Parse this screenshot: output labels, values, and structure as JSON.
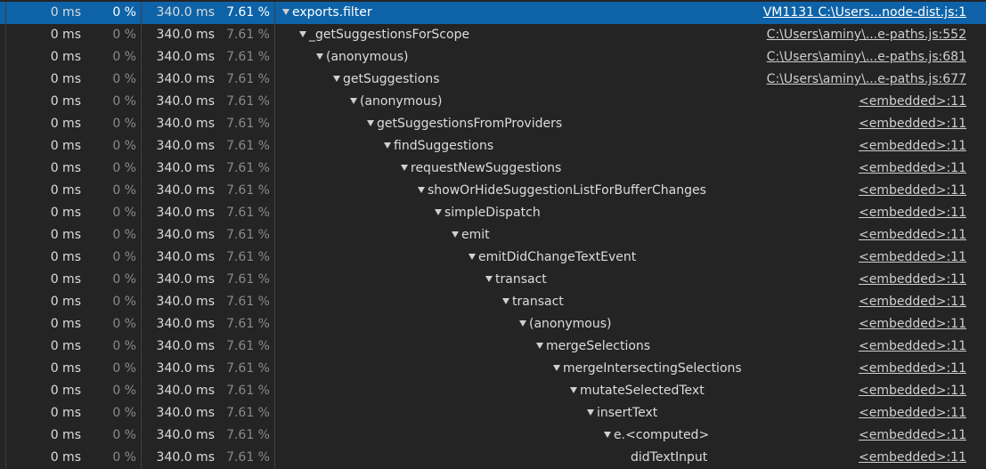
{
  "rows": [
    {
      "self": "0 ms",
      "self_pct": "0 %",
      "total": "340.0 ms",
      "total_pct": "7.61 %",
      "fn": "exports.filter",
      "src": "VM1131 C:\\Users...node-dist.js:1",
      "depth": 0,
      "expanded": true,
      "selected": true
    },
    {
      "self": "0 ms",
      "self_pct": "0 %",
      "total": "340.0 ms",
      "total_pct": "7.61 %",
      "fn": "_getSuggestionsForScope",
      "src": "C:\\Users\\aminy\\...e-paths.js:552",
      "depth": 1,
      "expanded": true
    },
    {
      "self": "0 ms",
      "self_pct": "0 %",
      "total": "340.0 ms",
      "total_pct": "7.61 %",
      "fn": "(anonymous)",
      "src": "C:\\Users\\aminy\\...e-paths.js:681",
      "depth": 2,
      "expanded": true
    },
    {
      "self": "0 ms",
      "self_pct": "0 %",
      "total": "340.0 ms",
      "total_pct": "7.61 %",
      "fn": "getSuggestions",
      "src": "C:\\Users\\aminy\\...e-paths.js:677",
      "depth": 3,
      "expanded": true
    },
    {
      "self": "0 ms",
      "self_pct": "0 %",
      "total": "340.0 ms",
      "total_pct": "7.61 %",
      "fn": "(anonymous)",
      "src": "<embedded>:11",
      "depth": 4,
      "expanded": true
    },
    {
      "self": "0 ms",
      "self_pct": "0 %",
      "total": "340.0 ms",
      "total_pct": "7.61 %",
      "fn": "getSuggestionsFromProviders",
      "src": "<embedded>:11",
      "depth": 5,
      "expanded": true
    },
    {
      "self": "0 ms",
      "self_pct": "0 %",
      "total": "340.0 ms",
      "total_pct": "7.61 %",
      "fn": "findSuggestions",
      "src": "<embedded>:11",
      "depth": 6,
      "expanded": true
    },
    {
      "self": "0 ms",
      "self_pct": "0 %",
      "total": "340.0 ms",
      "total_pct": "7.61 %",
      "fn": "requestNewSuggestions",
      "src": "<embedded>:11",
      "depth": 7,
      "expanded": true
    },
    {
      "self": "0 ms",
      "self_pct": "0 %",
      "total": "340.0 ms",
      "total_pct": "7.61 %",
      "fn": "showOrHideSuggestionListForBufferChanges",
      "src": "<embedded>:11",
      "depth": 8,
      "expanded": true
    },
    {
      "self": "0 ms",
      "self_pct": "0 %",
      "total": "340.0 ms",
      "total_pct": "7.61 %",
      "fn": "simpleDispatch",
      "src": "<embedded>:11",
      "depth": 9,
      "expanded": true
    },
    {
      "self": "0 ms",
      "self_pct": "0 %",
      "total": "340.0 ms",
      "total_pct": "7.61 %",
      "fn": "emit",
      "src": "<embedded>:11",
      "depth": 10,
      "expanded": true
    },
    {
      "self": "0 ms",
      "self_pct": "0 %",
      "total": "340.0 ms",
      "total_pct": "7.61 %",
      "fn": "emitDidChangeTextEvent",
      "src": "<embedded>:11",
      "depth": 11,
      "expanded": true
    },
    {
      "self": "0 ms",
      "self_pct": "0 %",
      "total": "340.0 ms",
      "total_pct": "7.61 %",
      "fn": "transact",
      "src": "<embedded>:11",
      "depth": 12,
      "expanded": true
    },
    {
      "self": "0 ms",
      "self_pct": "0 %",
      "total": "340.0 ms",
      "total_pct": "7.61 %",
      "fn": "transact",
      "src": "<embedded>:11",
      "depth": 13,
      "expanded": true
    },
    {
      "self": "0 ms",
      "self_pct": "0 %",
      "total": "340.0 ms",
      "total_pct": "7.61 %",
      "fn": "(anonymous)",
      "src": "<embedded>:11",
      "depth": 14,
      "expanded": true
    },
    {
      "self": "0 ms",
      "self_pct": "0 %",
      "total": "340.0 ms",
      "total_pct": "7.61 %",
      "fn": "mergeSelections",
      "src": "<embedded>:11",
      "depth": 15,
      "expanded": true
    },
    {
      "self": "0 ms",
      "self_pct": "0 %",
      "total": "340.0 ms",
      "total_pct": "7.61 %",
      "fn": "mergeIntersectingSelections",
      "src": "<embedded>:11",
      "depth": 16,
      "expanded": true
    },
    {
      "self": "0 ms",
      "self_pct": "0 %",
      "total": "340.0 ms",
      "total_pct": "7.61 %",
      "fn": "mutateSelectedText",
      "src": "<embedded>:11",
      "depth": 17,
      "expanded": true
    },
    {
      "self": "0 ms",
      "self_pct": "0 %",
      "total": "340.0 ms",
      "total_pct": "7.61 %",
      "fn": "insertText",
      "src": "<embedded>:11",
      "depth": 18,
      "expanded": true
    },
    {
      "self": "0 ms",
      "self_pct": "0 %",
      "total": "340.0 ms",
      "total_pct": "7.61 %",
      "fn": "e.<computed>",
      "src": "<embedded>:11",
      "depth": 19,
      "expanded": true
    },
    {
      "self": "0 ms",
      "self_pct": "0 %",
      "total": "340.0 ms",
      "total_pct": "7.61 %",
      "fn": "didTextInput",
      "src": "<embedded>:11",
      "depth": 20,
      "expanded": false
    }
  ],
  "colors": {
    "background": "#242424",
    "selected_row": "#0e63a8",
    "text": "#dcdcdc",
    "muted_text": "#8a8a8a",
    "divider": "#3e3e3e"
  },
  "icons": {
    "expand": "triangle-down-icon"
  }
}
